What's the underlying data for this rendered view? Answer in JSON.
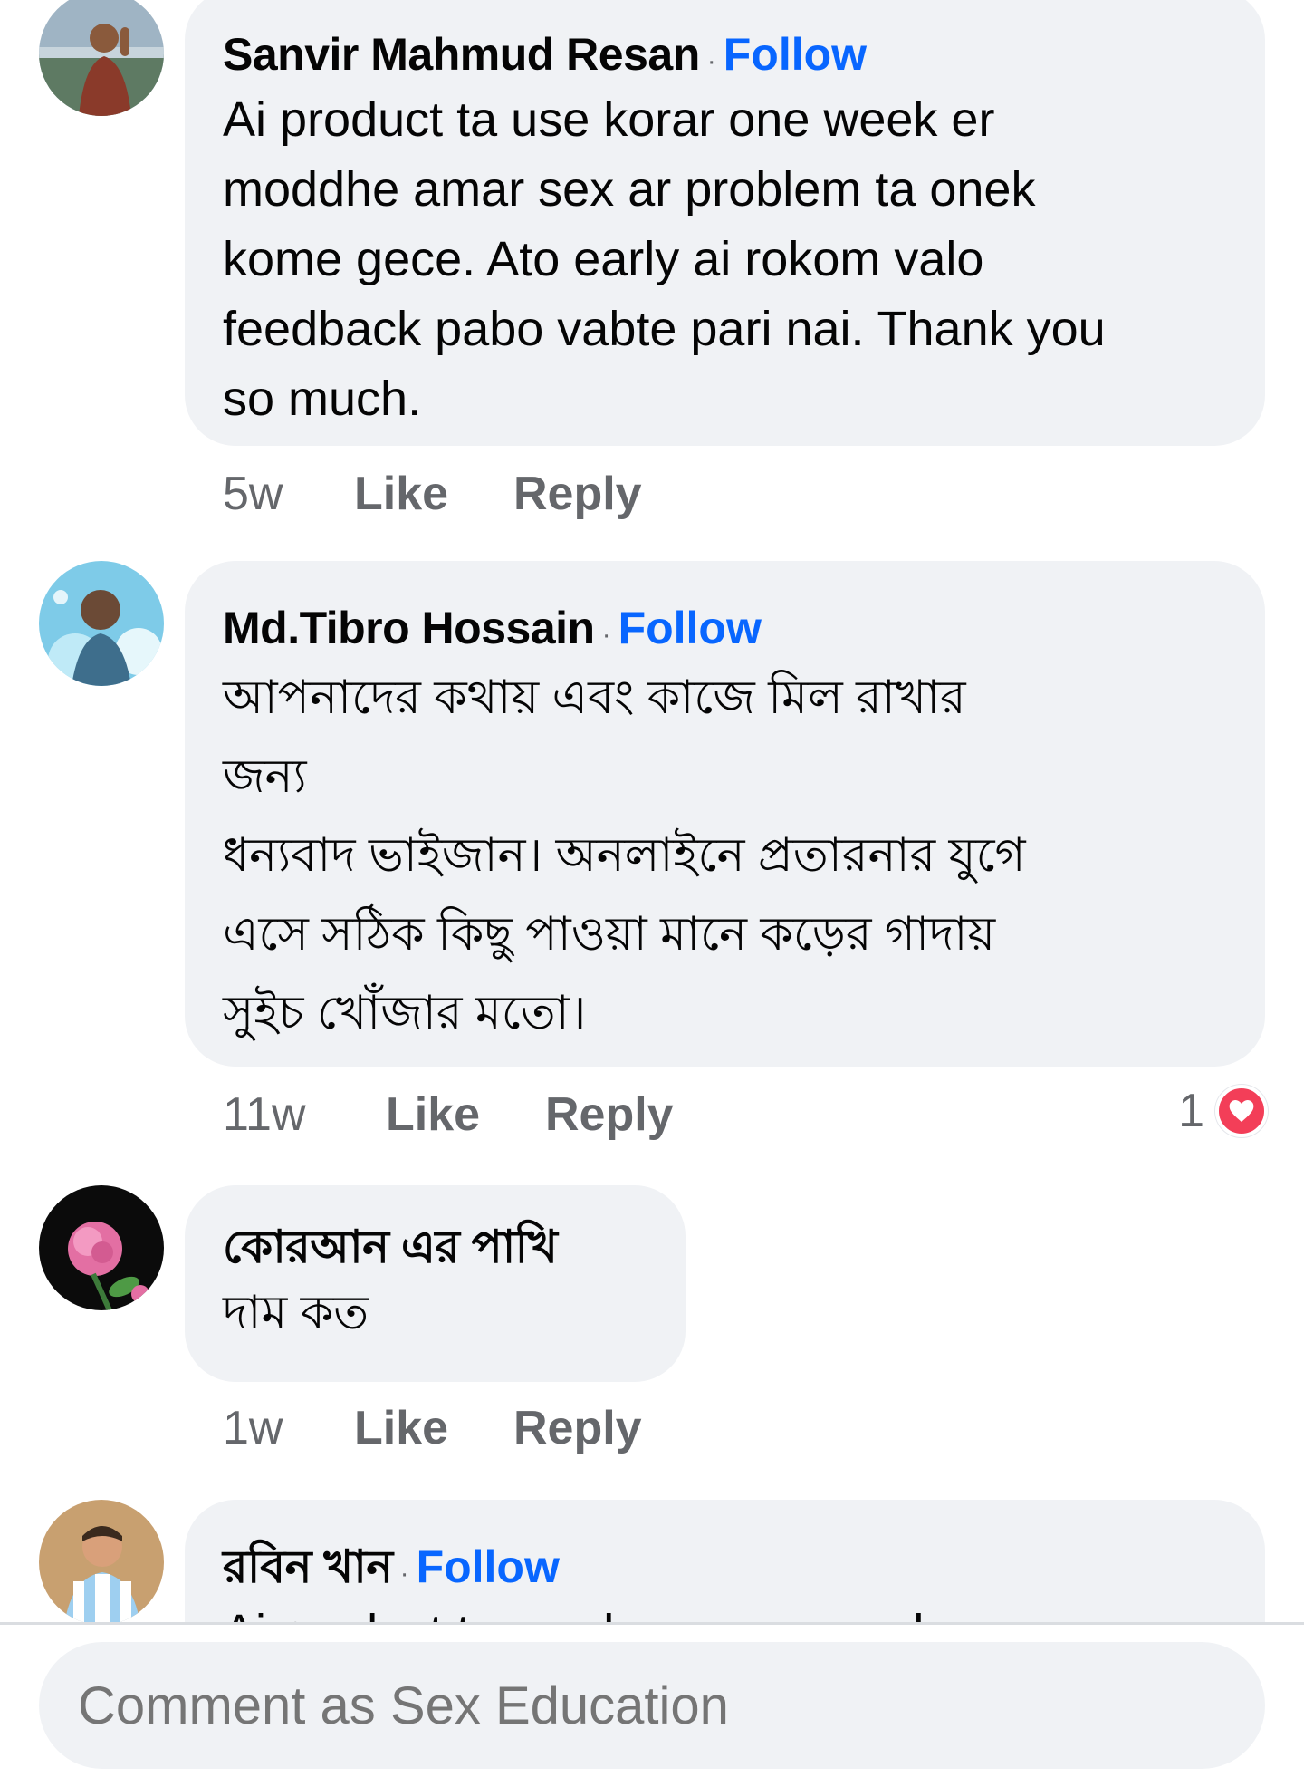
{
  "comments": [
    {
      "author": "Sanvir Mahmud Resan",
      "follow_label": "Follow",
      "separator": "·",
      "text_lines": [
        "Ai product ta use korar one week er",
        "moddhe amar sex ar problem ta onek",
        "kome gece. Ato early ai rokom valo",
        "feedback pabo vabte pari nai. Thank you",
        "so much."
      ],
      "time": "5w",
      "like_label": "Like",
      "reply_label": "Reply"
    },
    {
      "author": "Md.Tibro Hossain",
      "follow_label": "Follow",
      "separator": "·",
      "text_lines": [
        "আপনাদের কথায় এবং কাজে মিল রাখার",
        "জন্য",
        "ধন্যবাদ ভাইজান। অনলাইনে প্রতারনার যুগে",
        "এসে সঠিক কিছু পাওয়া মানে কড়ের গাদায়",
        "সুইচ খোঁজার মতো।"
      ],
      "time": "11w",
      "like_label": "Like",
      "reply_label": "Reply",
      "reaction_count": "1",
      "reaction_icon": "heart-icon"
    },
    {
      "author": "কোরআন এর পাখি",
      "text_lines": [
        "দাম কত"
      ],
      "time": "1w",
      "like_label": "Like",
      "reply_label": "Reply"
    },
    {
      "author": "রবিন খান",
      "follow_label": "Follow",
      "separator": "·",
      "text_lines": [
        "Ai product ta use korar one week er"
      ]
    }
  ],
  "composer": {
    "placeholder": "Comment as Sex Education"
  },
  "colors": {
    "bubble_bg": "#f0f2f5",
    "follow_blue": "#0866ff",
    "meta_gray": "#65676b",
    "love_red": "#f33e58"
  }
}
